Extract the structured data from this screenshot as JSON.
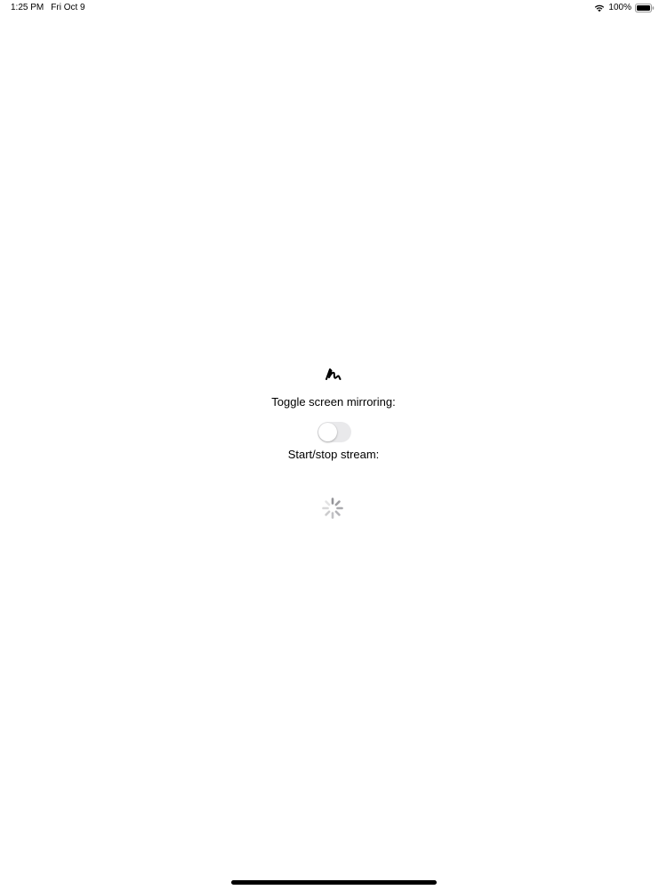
{
  "status_bar": {
    "time": "1:25 PM",
    "date": "Fri Oct 9",
    "battery_percent": "100%",
    "battery_level": 1.0,
    "wifi_icon": "wifi-icon",
    "battery_icon": "battery-icon"
  },
  "main": {
    "pencil_icon": "pencil-scribble-icon",
    "mirroring_label": "Toggle screen mirroring:",
    "mirroring_toggle_on": false,
    "stream_label": "Start/stop stream:",
    "spinner_icon": "activity-spinner-icon"
  },
  "colors": {
    "background": "#ffffff",
    "toggle_off_track": "#e9e9eb",
    "text": "#000000"
  }
}
